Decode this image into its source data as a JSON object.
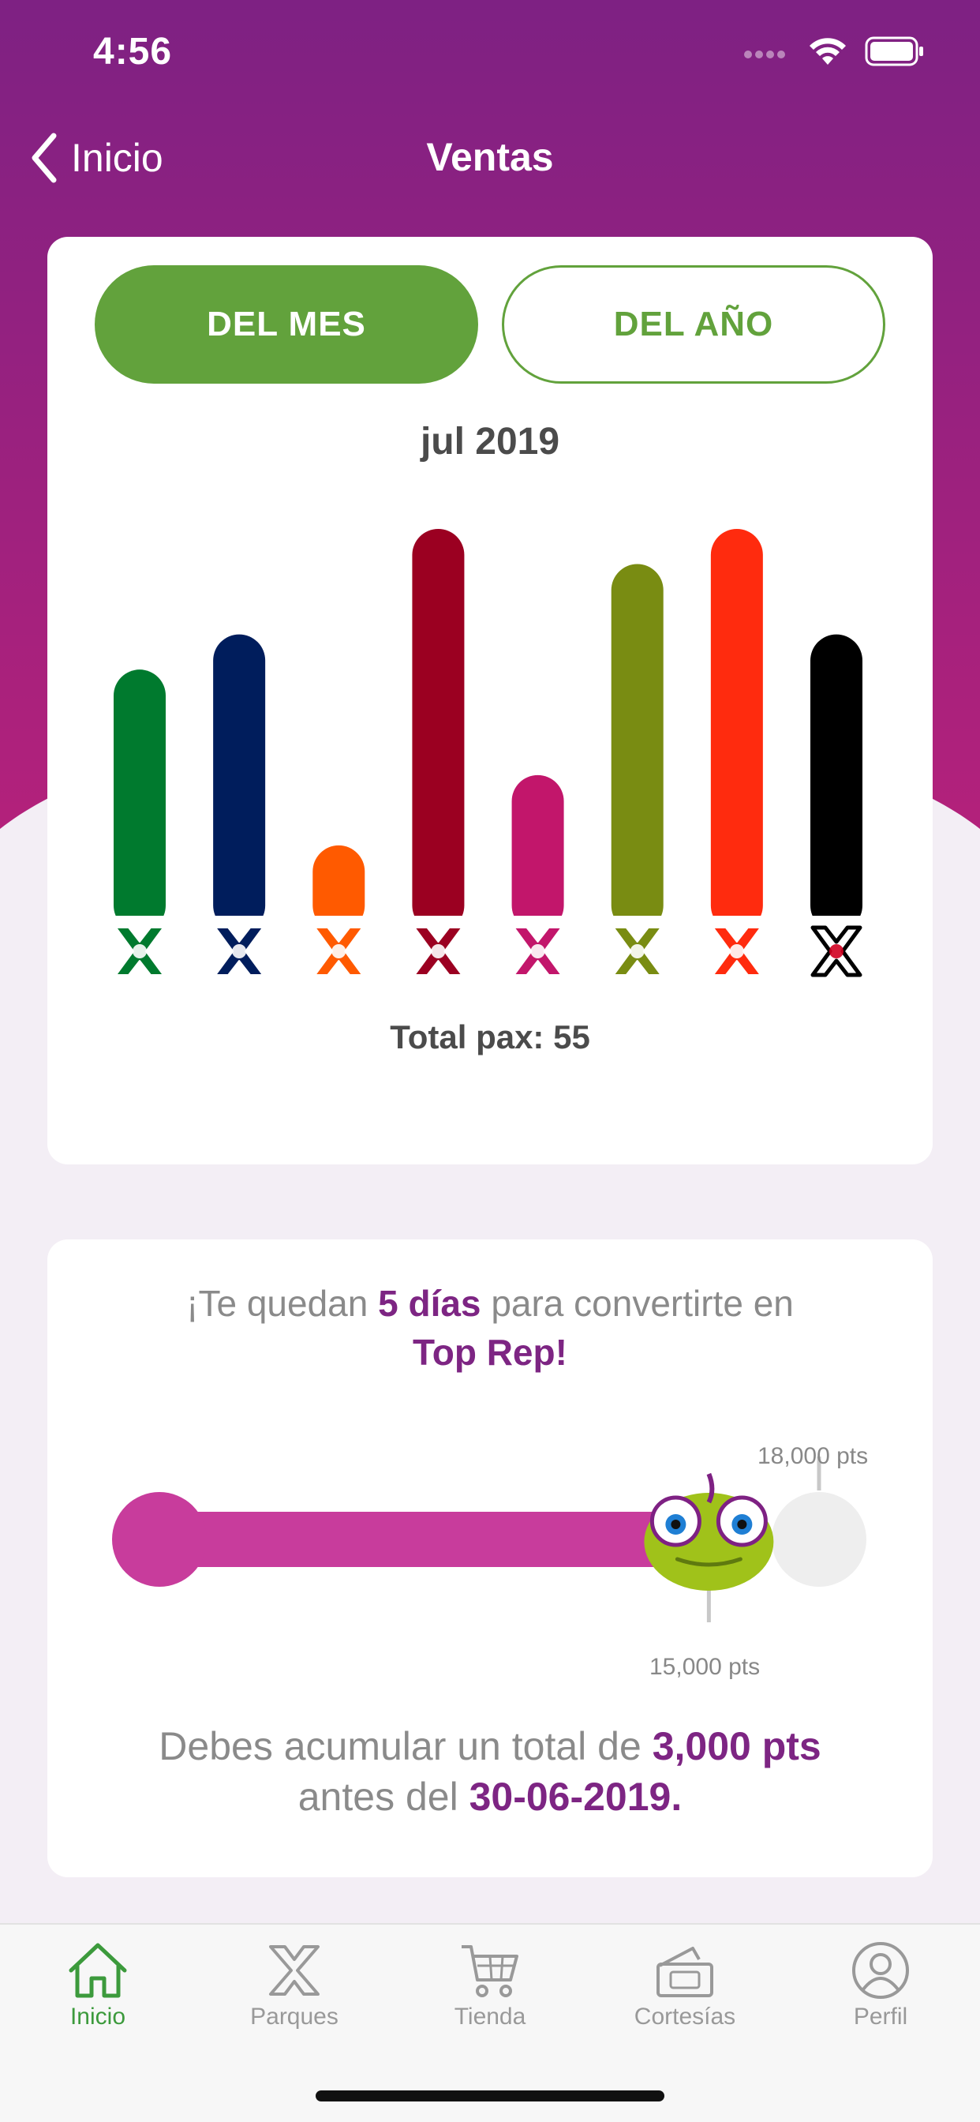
{
  "status_bar": {
    "time": "4:56"
  },
  "navbar": {
    "back_label": "Inicio",
    "title": "Ventas"
  },
  "sales": {
    "toggle_month": "DEL MES",
    "toggle_year": "DEL AÑO",
    "period": "jul 2019",
    "total_text": "Total pax: 55"
  },
  "chart_data": {
    "type": "bar",
    "categories": [
      "park-1",
      "park-2",
      "park-3",
      "park-4",
      "park-5",
      "park-6",
      "park-7",
      "park-8"
    ],
    "values": [
      7,
      8,
      2,
      11,
      4,
      10,
      11,
      8
    ],
    "colors": [
      "#007a2e",
      "#001d5c",
      "#ff5a00",
      "#9b0021",
      "#c2166b",
      "#798c12",
      "#ff2b0e",
      "#000000"
    ],
    "icon_names": [
      "macaw-x-icon",
      "fish-x-icon",
      "backpack-x-icon",
      "pyramid-x-icon",
      "flower-x-icon",
      "water-x-icon",
      "fire-x-icon",
      "heart-x-icon"
    ],
    "ylim": [
      0,
      11
    ]
  },
  "points": {
    "message_prefix": "¡Te quedan",
    "message_days": "5 días",
    "message_suffix": "para convertirte en",
    "message_goal": "Top Rep!",
    "goal_pts": "18,000 pts",
    "current_pts": "15,000 pts",
    "progress_fraction": 0.833,
    "bottom_prefix": "Debes acumular un total de",
    "bottom_amount": "3,000 pts",
    "bottom_mid": "antes del",
    "bottom_date": "30-06-2019."
  },
  "tabbar": [
    {
      "label": "Inicio",
      "icon": "home-icon",
      "active": true
    },
    {
      "label": "Parques",
      "icon": "parks-x-icon",
      "active": false
    },
    {
      "label": "Tienda",
      "icon": "cart-icon",
      "active": false
    },
    {
      "label": "Cortesías",
      "icon": "ticket-icon",
      "active": false
    },
    {
      "label": "Perfil",
      "icon": "profile-icon",
      "active": false
    }
  ],
  "colors": {
    "purple": "#7e2183",
    "magenta": "#c83c9c",
    "green": "#62a23c",
    "text_gray": "#4b4b4b"
  }
}
